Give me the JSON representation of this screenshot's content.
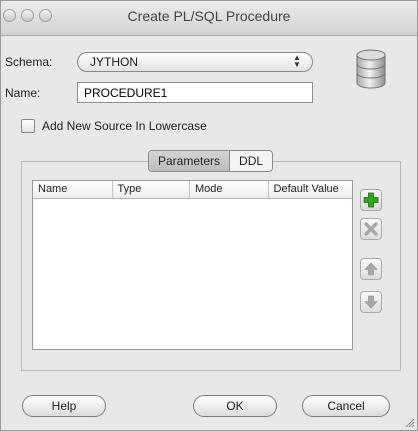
{
  "window": {
    "title": "Create PL/SQL Procedure"
  },
  "form": {
    "schema_label": "Schema:",
    "schema_value": "JYTHON",
    "name_label": "Name:",
    "name_value": "PROCEDURE1",
    "lowercase_label": "Add New Source In Lowercase",
    "lowercase_checked": false
  },
  "tabs": [
    {
      "label": "Parameters",
      "selected": true
    },
    {
      "label": "DDL",
      "selected": false
    }
  ],
  "table": {
    "columns": [
      "Name",
      "Type",
      "Mode",
      "Default Value"
    ],
    "rows": []
  },
  "side_buttons": {
    "add": "add-icon",
    "remove": "remove-icon",
    "move_up": "arrow-up-icon",
    "move_down": "arrow-down-icon"
  },
  "buttons": {
    "help": "Help",
    "ok": "OK",
    "cancel": "Cancel"
  },
  "colors": {
    "add_green": "#2fa51e",
    "disabled_gray": "#a8a8a8"
  }
}
